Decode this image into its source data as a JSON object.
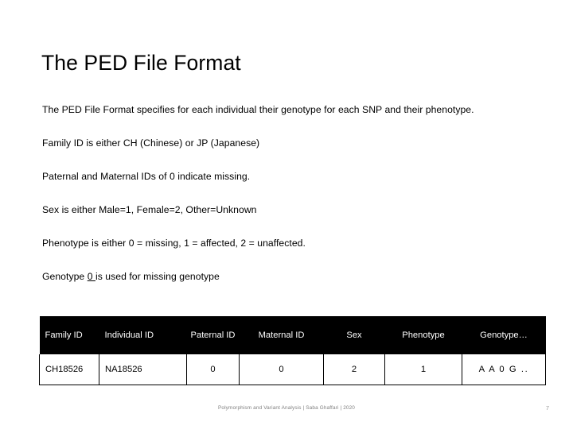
{
  "slide": {
    "title": "The PED File Format",
    "paragraphs": [
      {
        "id": "intro",
        "text": "The PED File Format specifies for each individual their genotype for each SNP and their phenotype."
      },
      {
        "id": "family-id",
        "text": "Family ID is either CH (Chinese) or JP (Japanese)"
      },
      {
        "id": "parent-ids",
        "text": "Paternal and Maternal IDs of 0 indicate missing."
      },
      {
        "id": "sex",
        "text": "Sex is either Male=1, Female=2, Other=Unknown"
      },
      {
        "id": "phenotype",
        "text": "Phenotype is either 0 = missing, 1 = affected, 2 = unaffected."
      }
    ],
    "genotype_line": {
      "prefix": "Genotype ",
      "underlined": "0 ",
      "suffix": "is used for missing genotype"
    },
    "table": {
      "headers": [
        "Family ID",
        "Individual ID",
        "Paternal ID",
        "Maternal ID",
        "Sex",
        "Phenotype",
        "Genotype…"
      ],
      "rows": [
        {
          "family_id": "CH18526",
          "individual_id": "NA18526",
          "paternal_id": "0",
          "maternal_id": "0",
          "sex": "2",
          "phenotype": "1",
          "genotype": "A A 0 G .."
        }
      ],
      "header_background": "#000000",
      "header_text_color": "#ffffff",
      "border_color": "#000000"
    },
    "footer": {
      "note": "Polymorphism and Variant Analysis | Saba Ghaffari | 2020",
      "page_number": "7"
    }
  }
}
